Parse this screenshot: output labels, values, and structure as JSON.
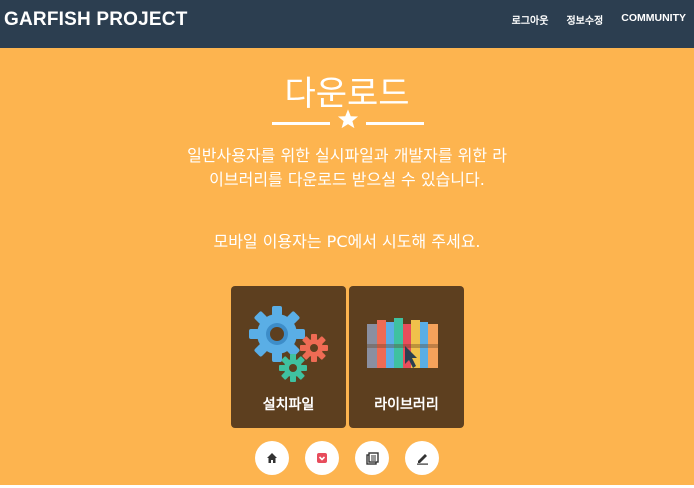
{
  "navbar": {
    "brand": "GARFISH PROJECT",
    "links": [
      {
        "label": "로그아웃"
      },
      {
        "label": "정보수정"
      },
      {
        "label": "COMMUNITY"
      }
    ]
  },
  "header": {
    "title": "다운로드",
    "description": "일반사용자를 위한 실시파일과 개발자를 위한 라이브러리를 다운로드 받으실 수 있습니다.",
    "mobile_note": "모바일 이용자는 PC에서 시도해 주세요."
  },
  "cards": [
    {
      "label": "설치파일",
      "icon": "gears-icon"
    },
    {
      "label": "라이브러리",
      "icon": "books-icon"
    }
  ],
  "bottom_icons": [
    {
      "icon": "home-icon"
    },
    {
      "icon": "pocket-icon",
      "color": "#e74c5c"
    },
    {
      "icon": "library-icon"
    },
    {
      "icon": "edit-icon"
    }
  ],
  "colors": {
    "background": "#fdb44f",
    "navbar": "#2c3e50",
    "card": "#5d3f1f"
  }
}
